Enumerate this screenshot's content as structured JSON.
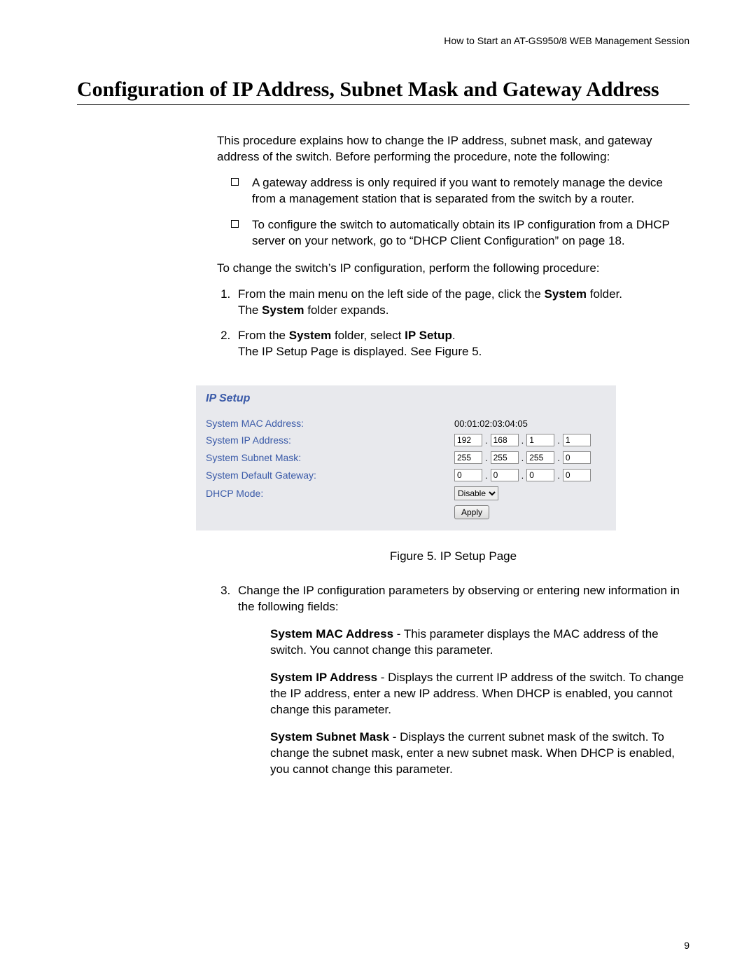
{
  "running_head": "How to Start an AT-GS950/8 WEB Management Session",
  "title": "Configuration of IP Address, Subnet Mask and Gateway Address",
  "intro": "This procedure explains how to change the IP address, subnet mask, and gateway address of the switch. Before performing the procedure, note the following:",
  "notes": {
    "n1": "A gateway address is only required if you want to remotely manage the device from a management station that is separated from the switch by a router.",
    "n2": "To configure the switch to automatically obtain its IP configuration from a DHCP server on your network, go to “DHCP Client Configuration” on page 18."
  },
  "lead": "To change the switch’s IP configuration, perform the following procedure:",
  "step1": {
    "pre": "From the main menu on the left side of the page, click the ",
    "bold": "System",
    "post": " folder.",
    "sub_pre": "The ",
    "sub_bold": "System",
    "sub_post": " folder expands."
  },
  "step2": {
    "pre": "From the ",
    "bold1": "System",
    "mid": " folder, select ",
    "bold2": "IP Setup",
    "post": ".",
    "sub": "The IP Setup Page is displayed. See Figure 5."
  },
  "panel": {
    "title": "IP Setup",
    "labels": {
      "mac": "System MAC Address:",
      "ip": "System IP Address:",
      "mask": "System Subnet Mask:",
      "gw": "System Default Gateway:",
      "dhcp": "DHCP Mode:"
    },
    "mac_value": "00:01:02:03:04:05",
    "ip": {
      "o1": "192",
      "o2": "168",
      "o3": "1",
      "o4": "1"
    },
    "mask": {
      "o1": "255",
      "o2": "255",
      "o3": "255",
      "o4": "0"
    },
    "gw": {
      "o1": "0",
      "o2": "0",
      "o3": "0",
      "o4": "0"
    },
    "dhcp_value": "Disable",
    "apply": "Apply"
  },
  "caption": "Figure 5. IP Setup Page",
  "step3": {
    "text": "Change the IP configuration parameters by observing or entering new information in the following fields:",
    "mac": {
      "bold": "System MAC Address",
      "rest": " - This parameter displays the MAC address of the switch. You cannot change this parameter."
    },
    "ip": {
      "bold": "System IP Address",
      "rest": " - Displays the current IP address of the switch. To change the IP address, enter a new IP address. When DHCP is enabled, you cannot change this parameter."
    },
    "mask": {
      "bold": "System Subnet Mask",
      "rest": " - Displays the current subnet mask of the switch. To change the subnet mask, enter a new subnet mask. When DHCP is enabled, you cannot change this parameter."
    }
  },
  "page_number": "9"
}
